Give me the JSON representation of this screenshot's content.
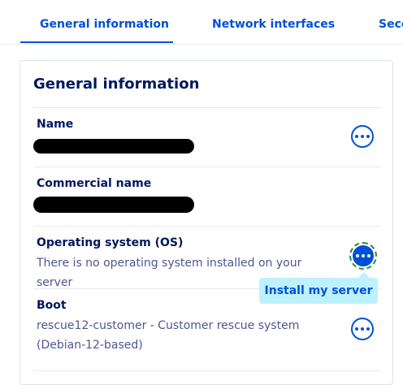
{
  "tabs": [
    {
      "label": "General information",
      "active": true
    },
    {
      "label": "Network interfaces",
      "active": false
    },
    {
      "label": "Secc",
      "active": false
    }
  ],
  "card": {
    "title": "General information",
    "rows": [
      {
        "label": "Name",
        "value": "",
        "redacted": true
      },
      {
        "label": "Commercial name",
        "value": "",
        "redacted": true
      },
      {
        "label": "Operating system (OS)",
        "value": "There is no operating system installed on your server",
        "redacted": false
      },
      {
        "label": "Boot",
        "value": "rescue12-customer - Customer rescue system (Debian-12-based)",
        "redacted": false
      }
    ]
  },
  "popup": {
    "item_label": "Install my server"
  },
  "colors": {
    "accent": "#0050d7",
    "title": "#00185e",
    "muted_text": "#4d5693",
    "popup_bg": "#bef1ff"
  }
}
